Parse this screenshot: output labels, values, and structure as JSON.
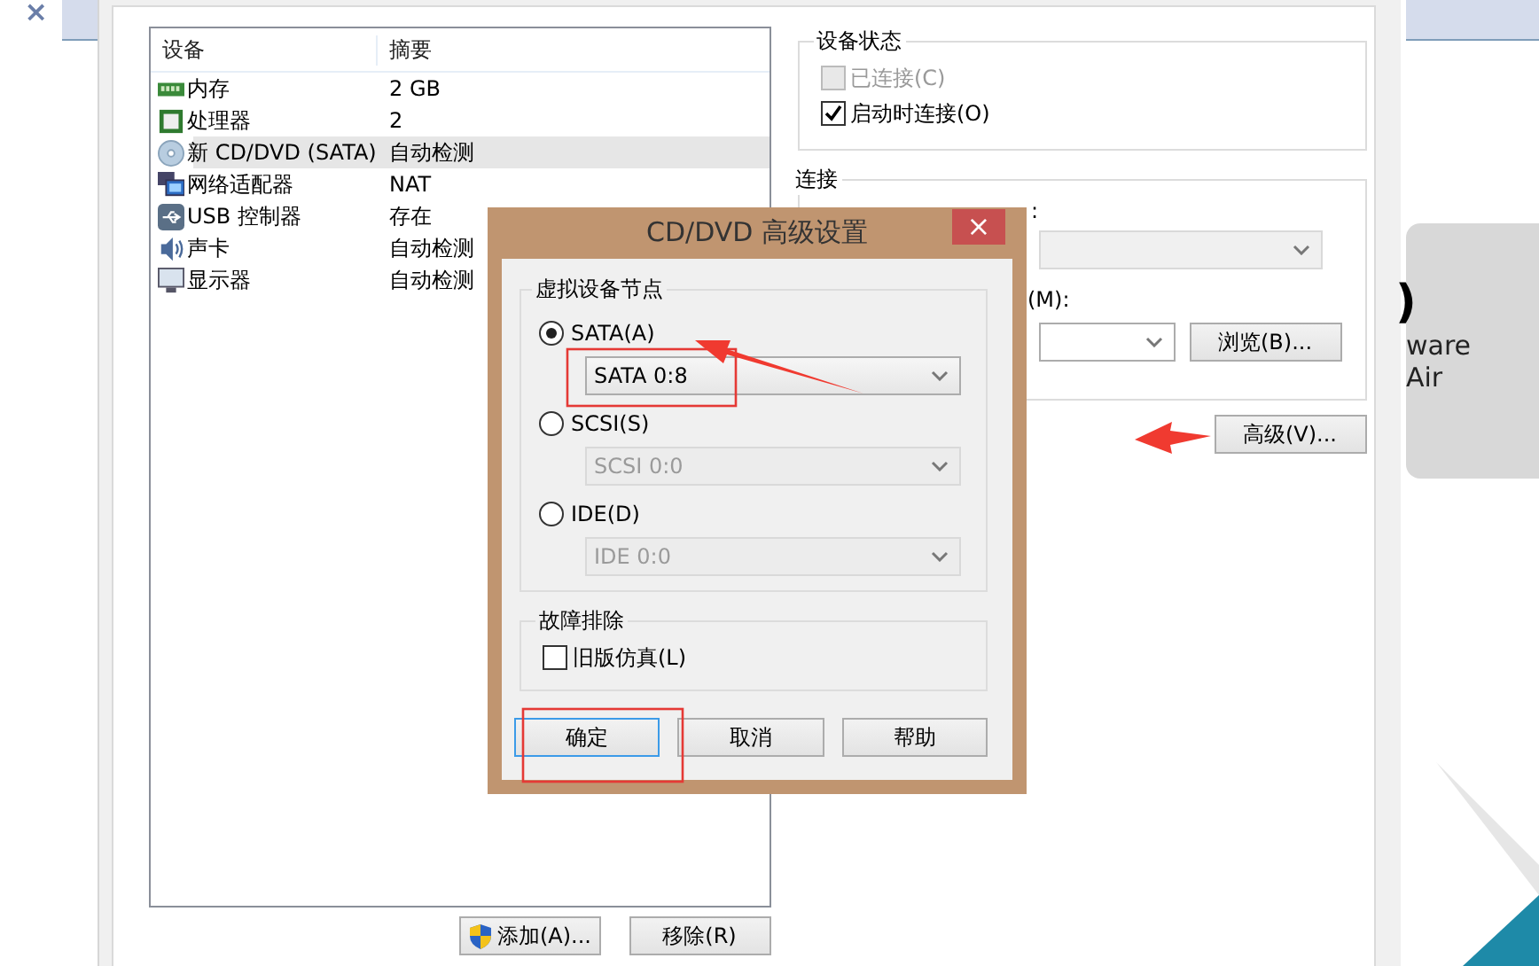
{
  "tab": {
    "close": "×"
  },
  "device_table": {
    "columns": [
      "设备",
      "摘要"
    ],
    "rows": [
      {
        "kind": "memory",
        "device": "内存",
        "summary": "2 GB",
        "selected": false
      },
      {
        "kind": "cpu",
        "device": "处理器",
        "summary": "2",
        "selected": false
      },
      {
        "kind": "disc",
        "device": "新 CD/DVD (SATA)",
        "summary": "自动检测",
        "selected": true
      },
      {
        "kind": "network",
        "device": "网络适配器",
        "summary": "NAT",
        "selected": false
      },
      {
        "kind": "usb",
        "device": "USB 控制器",
        "summary": "存在",
        "selected": false
      },
      {
        "kind": "sound",
        "device": "声卡",
        "summary": "自动检测",
        "selected": false
      },
      {
        "kind": "display",
        "device": "显示器",
        "summary": "自动检测",
        "selected": false
      }
    ]
  },
  "list_buttons": [
    {
      "label": "添加(A)...",
      "shield": true
    },
    {
      "label": "移除(R)",
      "shield": false
    }
  ],
  "device_status": {
    "title": "设备状态",
    "options": [
      {
        "label": "已连接(C)",
        "checked": false,
        "disabled": true
      },
      {
        "label": "启动时连接(O)",
        "checked": true,
        "disabled": false
      }
    ]
  },
  "connection": {
    "title": "连接",
    "label_1": ":",
    "label_2": "(M):",
    "browse_button": "浏览(B)..."
  },
  "advanced_button": "高级(V)...",
  "side_card": {
    "lines": [
      ")",
      "ware",
      "Air"
    ]
  },
  "dialog": {
    "title": "CD/DVD 高级设置",
    "close": "×",
    "node_group": {
      "title": "虚拟设备节点",
      "buses": [
        {
          "label": "SATA(A)",
          "selected": true,
          "slot": "SATA 0:8"
        },
        {
          "label": "SCSI(S)",
          "selected": false,
          "slot": "SCSI 0:0"
        },
        {
          "label": "IDE(D)",
          "selected": false,
          "slot": "IDE 0:0"
        }
      ]
    },
    "troubleshoot": {
      "title": "故障排除",
      "options": [
        {
          "label": "旧版仿真(L)",
          "checked": false
        }
      ]
    },
    "buttons": [
      {
        "label": "确定",
        "focused": true
      },
      {
        "label": "取消",
        "focused": false
      },
      {
        "label": "帮助",
        "focused": false
      }
    ]
  }
}
